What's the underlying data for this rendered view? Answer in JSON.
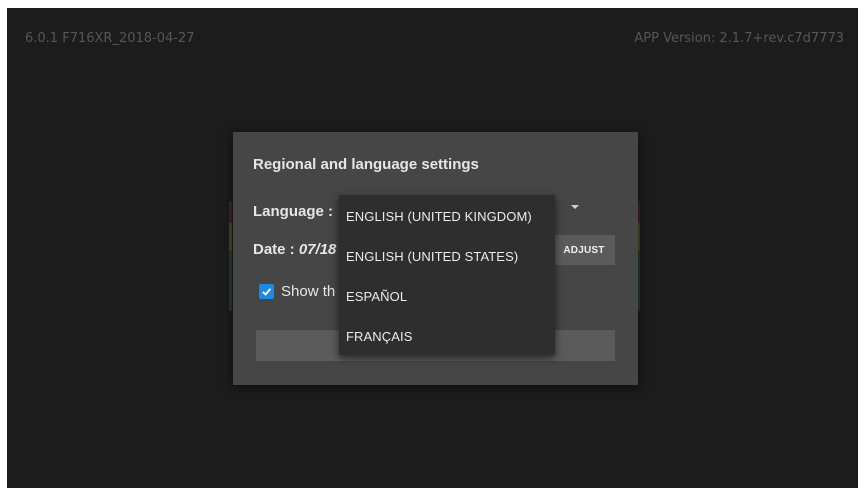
{
  "header": {
    "firmware": "6.0.1 F716XR_2018-04-27",
    "app_version": "APP Version: 2.1.7+rev.c7d7773"
  },
  "dialog": {
    "title": "Regional and language settings",
    "language_label": "Language :",
    "date_prefix": "Date : ",
    "date_value_partial": "07/18",
    "adjust_label": "ADJUST",
    "checkbox_label_partial": "Show th",
    "checkbox_checked": true
  },
  "language_menu": {
    "items": [
      "ENGLISH (UNITED KINGDOM)",
      "ENGLISH (UNITED STATES)",
      "ESPAÑOL",
      "FRANÇAIS"
    ]
  },
  "colors": {
    "screen_bg": "#1c1c1c",
    "dialog_bg": "#464646",
    "menu_bg": "#2e2e2e",
    "checkbox_accent": "#1e88e5"
  },
  "icons": {
    "dropdown": "chevron-down-icon",
    "check": "check-icon"
  }
}
